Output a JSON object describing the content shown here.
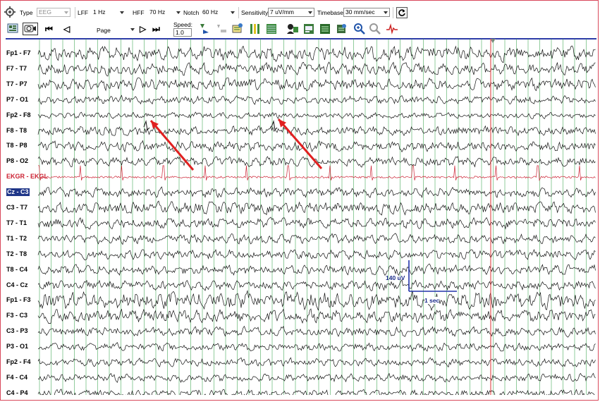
{
  "toolbar": {
    "type_label": "Type",
    "type_value": "EEG",
    "lff_label": "LFF",
    "lff_value": "1 Hz",
    "hff_label": "HFF",
    "hff_value": "70 Hz",
    "notch_label": "Notch",
    "notch_value": "60 Hz",
    "sensitivity_label": "Sensitivity",
    "sensitivity_value": "7 uV/mm",
    "timebase_label": "Timebase",
    "timebase_value": "30 mm/sec"
  },
  "toolbar2": {
    "page_label": "Page",
    "speed_label": "Speed:",
    "speed_value": "1.0"
  },
  "channels": [
    {
      "label": "Fp1 - F7",
      "type": "eeg",
      "amp": 0.55
    },
    {
      "label": "F7 - T7",
      "type": "eeg",
      "amp": 0.45
    },
    {
      "label": "T7 - P7",
      "type": "eeg",
      "amp": 0.45
    },
    {
      "label": "P7 - O1",
      "type": "eeg",
      "amp": 0.3
    },
    {
      "label": "Fp2 - F8",
      "type": "eeg",
      "amp": 0.22
    },
    {
      "label": "F8 - T8",
      "type": "eeg",
      "amp": 0.35
    },
    {
      "label": "T8 - P8",
      "type": "eeg",
      "amp": 0.4
    },
    {
      "label": "P8 - O2",
      "type": "eeg",
      "amp": 0.35
    },
    {
      "label": "EKGR - EKGL",
      "type": "ekg",
      "amp": 0.25
    },
    {
      "label": "Cz - C3",
      "type": "eeg",
      "amp": 0.35,
      "selected": true
    },
    {
      "label": "C3 - T7",
      "type": "eeg",
      "amp": 0.45
    },
    {
      "label": "T7 - T1",
      "type": "eeg",
      "amp": 0.4
    },
    {
      "label": "T1 - T2",
      "type": "eeg",
      "amp": 0.35
    },
    {
      "label": "T2 - T8",
      "type": "eeg",
      "amp": 0.35
    },
    {
      "label": "T8 - C4",
      "type": "eeg",
      "amp": 0.35
    },
    {
      "label": "C4 - Cz",
      "type": "eeg",
      "amp": 0.35
    },
    {
      "label": "Fp1 - F3",
      "type": "eeg",
      "amp": 0.65
    },
    {
      "label": "F3 - C3",
      "type": "eeg",
      "amp": 0.5
    },
    {
      "label": "C3 - P3",
      "type": "eeg",
      "amp": 0.35
    },
    {
      "label": "P3 - O1",
      "type": "eeg",
      "amp": 0.3
    },
    {
      "label": "Fp2 - F4",
      "type": "eeg",
      "amp": 0.3
    },
    {
      "label": "F4 - C4",
      "type": "eeg",
      "amp": 0.3
    },
    {
      "label": "C4 - P4",
      "type": "eeg",
      "amp": 0.3
    }
  ],
  "calibration": {
    "amplitude_label": "140 uV",
    "time_label": "1 sec"
  },
  "colors": {
    "gridline": "#2ea043",
    "trace": "#111111",
    "ekg": "#cc2233",
    "cursor": "#e05050",
    "calibration": "#2233aa",
    "arrow": "#e02020"
  }
}
